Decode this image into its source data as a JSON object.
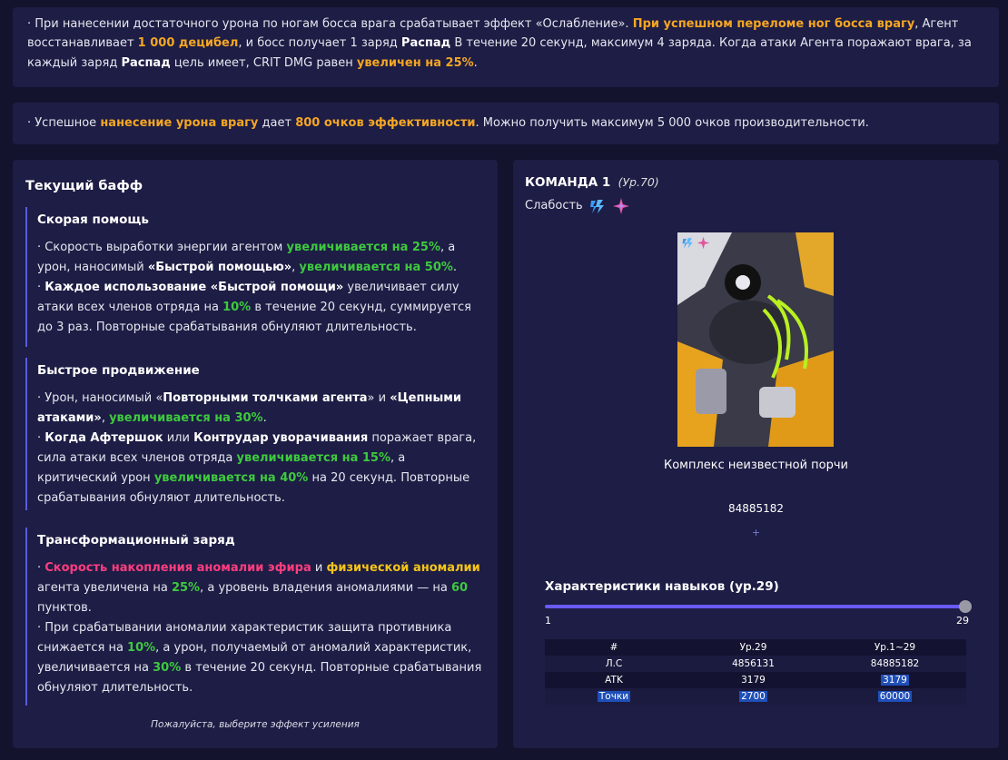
{
  "top": {
    "p1": [
      {
        "t": "· При нанесении достаточного урона по ногам босса врага срабатывает эффект «Ослабление». ",
        "c": ""
      },
      {
        "t": "При успешном переломе ног босса врагу",
        "c": "o"
      },
      {
        "t": ", Агент восстанавливает ",
        "c": ""
      },
      {
        "t": "1 000 децибел",
        "c": "o"
      },
      {
        "t": ", и босс получает 1 заряд ",
        "c": ""
      },
      {
        "t": "Распад",
        "c": "w"
      },
      {
        "t": " В течение 20 секунд, максимум 4 заряда. Когда атаки Агента поражают врага, за каждый заряд ",
        "c": ""
      },
      {
        "t": "Распад",
        "c": "w"
      },
      {
        "t": " цель имеет, CRIT DMG равен ",
        "c": ""
      },
      {
        "t": "увеличен на 25%",
        "c": "o"
      },
      {
        "t": ".",
        "c": ""
      }
    ],
    "p2": [
      {
        "t": "· Успешное ",
        "c": ""
      },
      {
        "t": "нанесение урона врагу",
        "c": "o"
      },
      {
        "t": " дает ",
        "c": ""
      },
      {
        "t": "800 очков эффективности",
        "c": "o"
      },
      {
        "t": ". Можно получить максимум 5 000 очков производительности.",
        "c": ""
      }
    ]
  },
  "buff_panel": {
    "title": "Текущий бафф",
    "buffs": [
      {
        "name": "Скорая помощь",
        "lines": [
          [
            {
              "t": "· Скорость выработки энергии агентом ",
              "c": ""
            },
            {
              "t": "увеличивается на 25%",
              "c": "g"
            },
            {
              "t": ", а урон, наносимый ",
              "c": ""
            },
            {
              "t": "«Быстрой помощью»",
              "c": "w"
            },
            {
              "t": ", ",
              "c": ""
            },
            {
              "t": "увеличивается на 50%",
              "c": "g"
            },
            {
              "t": ".",
              "c": ""
            }
          ],
          [
            {
              "t": "· ",
              "c": ""
            },
            {
              "t": "Каждое использование «Быстрой помощи»",
              "c": "w"
            },
            {
              "t": " увеличивает силу атаки всех членов отряда на ",
              "c": ""
            },
            {
              "t": "10%",
              "c": "g"
            },
            {
              "t": " в течение 20 секунд, суммируется до 3 раз. Повторные срабатывания обнуляют длительность.",
              "c": ""
            }
          ]
        ]
      },
      {
        "name": "Быстрое продвижение",
        "lines": [
          [
            {
              "t": "· Урон, наносимый «",
              "c": ""
            },
            {
              "t": "Повторными толчками агента",
              "c": "w"
            },
            {
              "t": "» и ",
              "c": ""
            },
            {
              "t": "«Цепными атаками»",
              "c": "w"
            },
            {
              "t": ", ",
              "c": ""
            },
            {
              "t": "увеличивается на 30%",
              "c": "g"
            },
            {
              "t": ".",
              "c": ""
            }
          ],
          [
            {
              "t": "· ",
              "c": ""
            },
            {
              "t": "Когда Афтершок",
              "c": "w"
            },
            {
              "t": " или ",
              "c": ""
            },
            {
              "t": "Контрудар уворачивания",
              "c": "w"
            },
            {
              "t": " поражает врага, сила атаки всех членов отряда ",
              "c": ""
            },
            {
              "t": "увеличивается на 15%",
              "c": "g"
            },
            {
              "t": ", а критический урон ",
              "c": ""
            },
            {
              "t": "увеличивается на 40%",
              "c": "g"
            },
            {
              "t": " на 20 секунд. Повторные срабатывания обнуляют длительность.",
              "c": ""
            }
          ]
        ]
      },
      {
        "name": "Трансформационный заряд",
        "lines": [
          [
            {
              "t": "· ",
              "c": ""
            },
            {
              "t": "Скорость накопления аномалии эфира",
              "c": "p"
            },
            {
              "t": " и ",
              "c": ""
            },
            {
              "t": "физической аномалии",
              "c": "y"
            },
            {
              "t": " агента увеличена на ",
              "c": ""
            },
            {
              "t": "25%",
              "c": "g"
            },
            {
              "t": ", а уровень владения аномалиями — на ",
              "c": ""
            },
            {
              "t": "60",
              "c": "g"
            },
            {
              "t": " пунктов.",
              "c": ""
            }
          ],
          [
            {
              "t": "· При срабатывании аномалии характеристик защита противника снижается на ",
              "c": ""
            },
            {
              "t": "10%",
              "c": "g"
            },
            {
              "t": ", а урон, получаемый от аномалий характеристик, увеличивается на ",
              "c": ""
            },
            {
              "t": "30%",
              "c": "g"
            },
            {
              "t": " в течение 20 секунд. Повторные срабатывания обнуляют длительность.",
              "c": ""
            }
          ]
        ]
      }
    ],
    "footer": "Пожалуйста, выберите эффект усиления"
  },
  "team": {
    "title": "КОМАНДА 1",
    "level": "(Ур.70)",
    "weakness_label": "Слабость",
    "weakness_icons": [
      "electric-icon",
      "ether-icon"
    ],
    "enemy_name": "Комплекс неизвестной порчи",
    "enemy_value": "84885182",
    "plus": "+"
  },
  "skills": {
    "title": "Характеристики навыков (ур.29)",
    "slider_min": "1",
    "slider_max": "29",
    "slider_value": 29,
    "headers": [
      "#",
      "Ур.29",
      "Ур.1~29"
    ],
    "rows": [
      [
        "Л.С",
        "4856131",
        "84885182"
      ],
      [
        "ATK",
        "3179",
        "3179"
      ],
      [
        "Точки",
        "2700",
        "60000"
      ]
    ]
  },
  "colors": {
    "background": "#13132e",
    "panel": "#1d1d45",
    "orange": "#f5a623",
    "green": "#3ec93e",
    "pink": "#ff3d7f",
    "yellow": "#f5c518",
    "accent": "#5b5be0"
  }
}
